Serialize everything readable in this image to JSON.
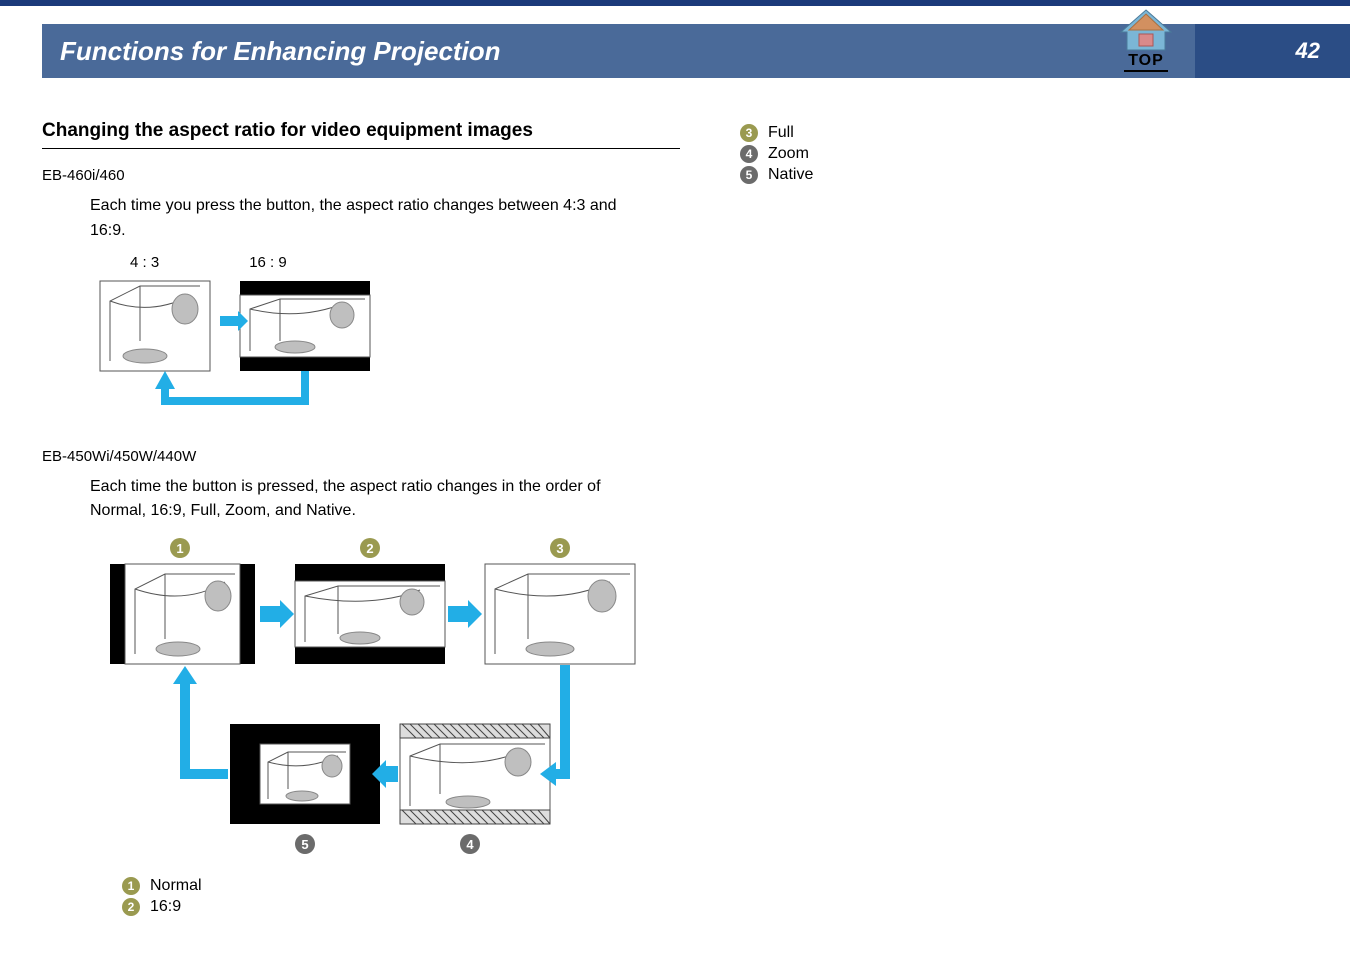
{
  "header": {
    "title": "Functions for Enhancing Projection",
    "page_number": "42",
    "top_label": "TOP"
  },
  "section": {
    "heading": "Changing the aspect ratio for video equipment images",
    "model_a": "EB-460i/460",
    "desc_a": "Each time you press the button, the aspect ratio changes between 4:3 and 16:9.",
    "aspect_a_left": "4 : 3",
    "aspect_a_right": "16 : 9",
    "model_b": "EB-450Wi/450W/440W",
    "desc_b": "Each time the button is pressed, the aspect ratio changes in the order of Normal, 16:9, Full, Zoom, and Native."
  },
  "legend_left": [
    {
      "n": "1",
      "label": "Normal"
    },
    {
      "n": "2",
      "label": "16:9"
    }
  ],
  "legend_right": [
    {
      "n": "3",
      "label": "Full"
    },
    {
      "n": "4",
      "label": "Zoom"
    },
    {
      "n": "5",
      "label": "Native"
    }
  ]
}
